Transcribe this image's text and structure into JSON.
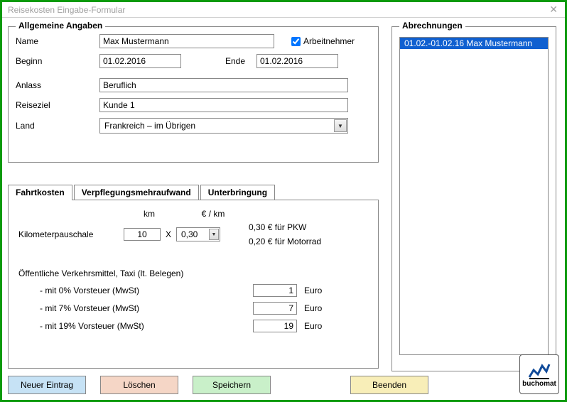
{
  "window": {
    "title": "Reisekosten Eingabe-Formular"
  },
  "allgemein": {
    "legend": "Allgemeine Angaben",
    "name_label": "Name",
    "name_value": "Max Mustermann",
    "arbeitnehmer_label": "Arbeitnehmer",
    "arbeitnehmer_checked": true,
    "beginn_label": "Beginn",
    "beginn_value": "01.02.2016",
    "ende_label": "Ende",
    "ende_value": "01.02.2016",
    "anlass_label": "Anlass",
    "anlass_value": "Beruflich",
    "reiseziel_label": "Reiseziel",
    "reiseziel_value": "Kunde 1",
    "land_label": "Land",
    "land_value": "Frankreich – im Übrigen"
  },
  "tabs": {
    "fahrtkosten": "Fahrtkosten",
    "verpflegung": "Verpflegungsmehraufwand",
    "unterbringung": "Unterbringung"
  },
  "fahrt": {
    "kilometer_label": "Kilometerpauschale",
    "km_header": "km",
    "eurokm_header": "€ / km",
    "km_value": "10",
    "x": "X",
    "rate_value": "0,30",
    "rate_pkw": "0,30 € für PKW",
    "rate_moto": "0,20 € für Motorrad",
    "public_title": "Öffentliche Verkehrsmittel, Taxi (lt. Belegen)",
    "vat0_label": "- mit 0% Vorsteuer (MwSt)",
    "vat0_value": "1",
    "vat7_label": "- mit 7% Vorsteuer (MwSt)",
    "vat7_value": "7",
    "vat19_label": "- mit 19% Vorsteuer (MwSt)",
    "vat19_value": "19",
    "euro_label": "Euro"
  },
  "abrechnungen": {
    "legend": "Abrechnungen",
    "items": [
      "01.02.-01.02.16 Max Mustermann"
    ]
  },
  "buttons": {
    "neu": "Neuer Eintrag",
    "loeschen": "Löschen",
    "speichern": "Speichern",
    "beenden": "Beenden"
  },
  "logo": {
    "text": "buchomat"
  }
}
